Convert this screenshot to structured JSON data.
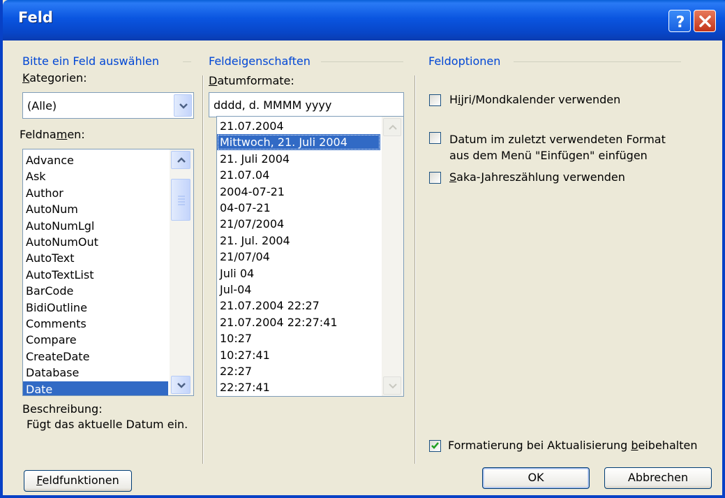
{
  "window": {
    "title": "Feld"
  },
  "left": {
    "group_title": "Bitte ein Feld auswählen",
    "categories_label": "Kategorien:",
    "category_value": "(Alle)",
    "fieldnames_label": "Feldnamen:",
    "fieldnames": [
      "Advance",
      "Ask",
      "Author",
      "AutoNum",
      "AutoNumLgl",
      "AutoNumOut",
      "AutoText",
      "AutoTextList",
      "BarCode",
      "BidiOutline",
      "Comments",
      "Compare",
      "CreateDate",
      "Database",
      "Date"
    ],
    "selected": "Date",
    "description_label": "Beschreibung:",
    "description_text": "Fügt das aktuelle Datum ein."
  },
  "middle": {
    "group_title": "Feldeigenschaften",
    "formats_label": "Datumformate:",
    "format_value": "dddd, d. MMMM yyyy",
    "formats": [
      "21.07.2004",
      "Mittwoch, 21. Juli 2004",
      "21. Juli 2004",
      "21.07.04",
      "2004-07-21",
      "04-07-21",
      "21/07/2004",
      "21. Jul. 2004",
      "21/07/04",
      "Juli 04",
      "Jul-04",
      "21.07.2004 22:27",
      "21.07.2004 22:27:41",
      "10:27",
      "10:27:41",
      "22:27",
      "22:27:41"
    ],
    "selected": "Mittwoch, 21. Juli 2004"
  },
  "right": {
    "group_title": "Feldoptionen",
    "opt_hijri": "Hijri/Mondkalender verwenden",
    "opt_lastformat_1": "Datum im zuletzt verwendeten Format",
    "opt_lastformat_2": "aus dem Menü \"Einfügen\" einfügen",
    "opt_saka": "Saka-Jahreszählung verwenden",
    "opt_keepformat": "Formatierung bei Aktualisierung beibehalten",
    "keepformat_checked": true
  },
  "buttons": {
    "field_codes": "Feldfunktionen",
    "ok": "OK",
    "cancel": "Abbrechen"
  }
}
